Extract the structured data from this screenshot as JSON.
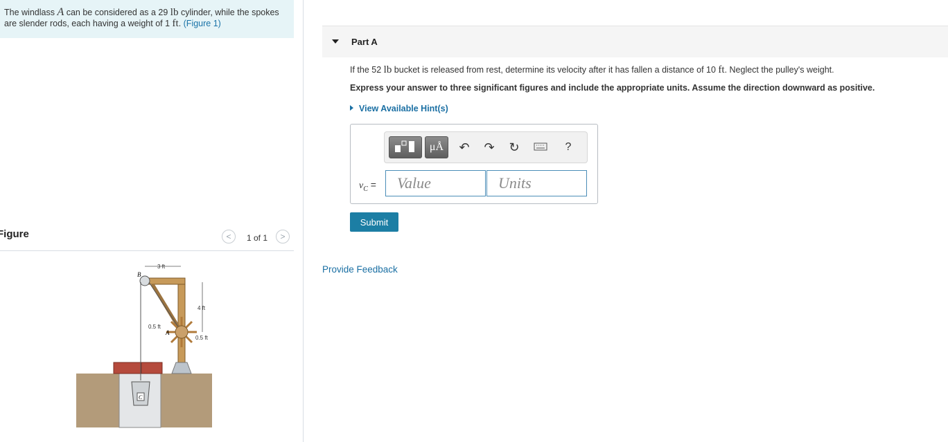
{
  "problem": {
    "text_a": "The windlass ",
    "var_a": "A",
    "text_b": " can be considered as a 29 ",
    "unit_lb": "lb",
    "text_c": " cylinder, while the spokes are slender rods, each having a weight of 1 ",
    "unit_ft": "ft",
    "text_d": ". ",
    "figure_link": "(Figure 1)"
  },
  "figure_panel": {
    "heading": "Figure",
    "pager_text": "1 of 1",
    "prev": "<",
    "next": ">",
    "labels": {
      "dim_3ft": "3 ft",
      "B": "B",
      "dim_4ft": "4 ft",
      "dim_05ft_left": "0.5 ft",
      "A": "A",
      "dim_05ft_right": "0.5 ft",
      "C": "C"
    }
  },
  "part": {
    "title": "Part A",
    "question_a": "If the 52 ",
    "question_unit_lb": "lb",
    "question_b": " bucket is released from rest, determine its velocity after it has fallen a distance of 10 ",
    "question_unit_ft": "ft",
    "question_c": ". Neglect the pulley's weight.",
    "instruction": "Express your answer to three significant figures and include the appropriate units. Assume the direction downward as positive.",
    "hint": "View Available Hint(s)"
  },
  "answer": {
    "var": "v",
    "var_sub": "C",
    "equals": " =",
    "value_placeholder": "Value",
    "units_placeholder": "Units",
    "toolbar": {
      "units_btn": "μÅ",
      "help": "?"
    },
    "submit": "Submit"
  },
  "feedback": "Provide Feedback",
  "colors": {
    "link": "#1a6fa3",
    "submit_bg": "#1c7ea4",
    "problem_bg": "#e6f4f7",
    "field_border": "#4a8db7"
  },
  "icons": [
    "templates-icon",
    "units-icon",
    "undo-icon",
    "redo-icon",
    "reset-icon",
    "keyboard-icon",
    "help-icon"
  ]
}
